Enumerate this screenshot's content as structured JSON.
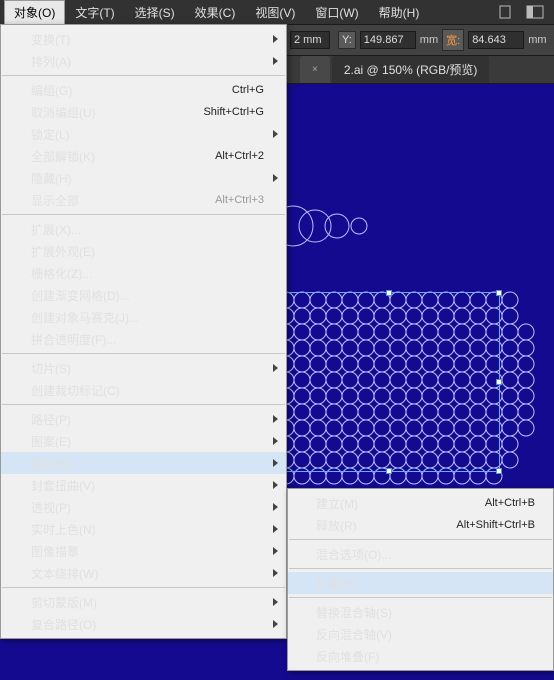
{
  "menubar": {
    "items": [
      "对象(O)",
      "文字(T)",
      "选择(S)",
      "效果(C)",
      "视图(V)",
      "窗口(W)",
      "帮助(H)"
    ],
    "active_index": 0
  },
  "toolbar": {
    "x_suffix": "2 mm",
    "y_label": "Y:",
    "y_value": "149.867",
    "w_label": "宽:",
    "w_value": "84.643",
    "unit": "mm"
  },
  "tabs": {
    "active_label": "2.ai @ 150% (RGB/预览)"
  },
  "menu": {
    "groups": [
      [
        {
          "label": "变换(T)",
          "sub": true
        },
        {
          "label": "排列(A)",
          "sub": true
        }
      ],
      [
        {
          "label": "编组(G)",
          "shortcut": "Ctrl+G"
        },
        {
          "label": "取消编组(U)",
          "shortcut": "Shift+Ctrl+G"
        },
        {
          "label": "锁定(L)",
          "sub": true
        },
        {
          "label": "全部解锁(K)",
          "shortcut": "Alt+Ctrl+2"
        },
        {
          "label": "隐藏(H)",
          "sub": true
        },
        {
          "label": "显示全部",
          "shortcut": "Alt+Ctrl+3",
          "disabled": true
        }
      ],
      [
        {
          "label": "扩展(X)..."
        },
        {
          "label": "扩展外观(E)",
          "disabled": true
        },
        {
          "label": "栅格化(Z)..."
        },
        {
          "label": "创建渐变网格(D)..."
        },
        {
          "label": "创建对象马赛克(J)..."
        },
        {
          "label": "拼合透明度(F)..."
        }
      ],
      [
        {
          "label": "切片(S)",
          "sub": true
        },
        {
          "label": "创建裁切标记(C)"
        }
      ],
      [
        {
          "label": "路径(P)",
          "sub": true
        },
        {
          "label": "图案(E)",
          "sub": true
        },
        {
          "label": "混合(B)",
          "sub": true,
          "highlight": true
        },
        {
          "label": "封套扭曲(V)",
          "sub": true
        },
        {
          "label": "透视(P)",
          "sub": true
        },
        {
          "label": "实时上色(N)",
          "sub": true
        },
        {
          "label": "图像描摹",
          "sub": true
        },
        {
          "label": "文本绕排(W)",
          "sub": true
        }
      ],
      [
        {
          "label": "剪切蒙版(M)",
          "sub": true
        },
        {
          "label": "复合路径(O)",
          "sub": true
        }
      ]
    ]
  },
  "submenu": {
    "groups": [
      [
        {
          "label": "建立(M)",
          "shortcut": "Alt+Ctrl+B"
        },
        {
          "label": "释放(R)",
          "shortcut": "Alt+Shift+Ctrl+B"
        }
      ],
      [
        {
          "label": "混合选项(O)..."
        }
      ],
      [
        {
          "label": "扩展(E)",
          "highlight": true
        }
      ],
      [
        {
          "label": "替换混合轴(S)",
          "disabled": true
        },
        {
          "label": "反向混合轴(V)"
        },
        {
          "label": "反向堆叠(F)"
        }
      ]
    ]
  }
}
